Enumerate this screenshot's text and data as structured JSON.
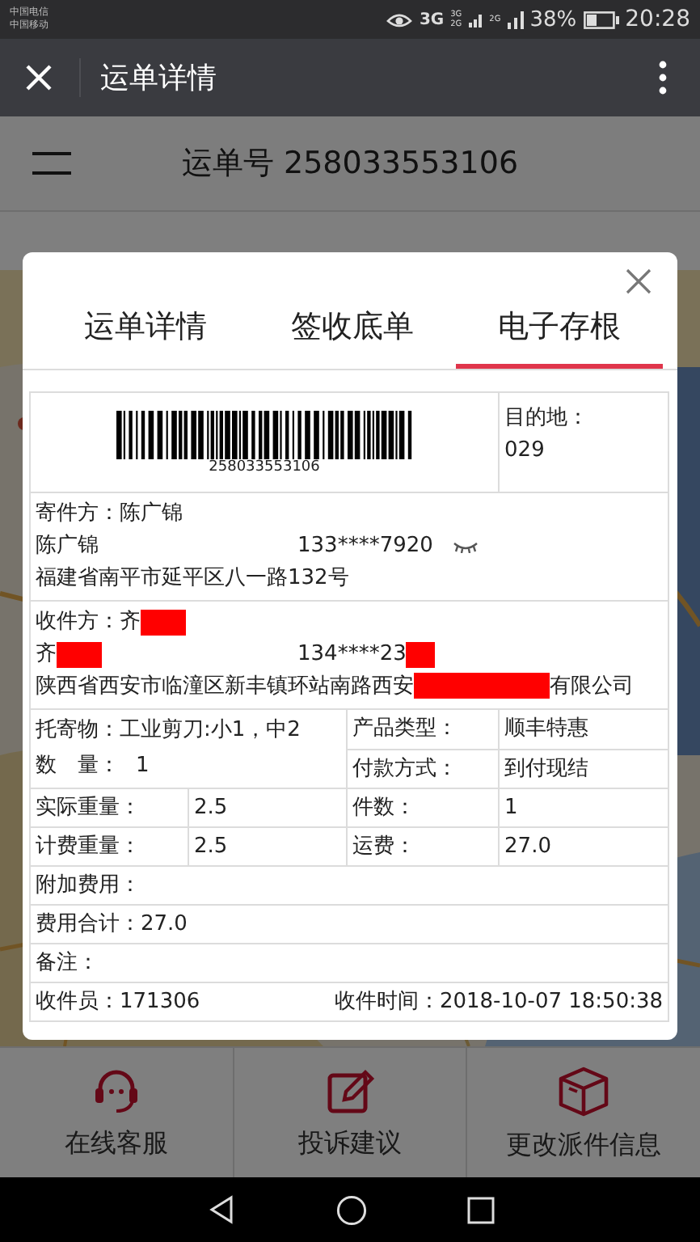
{
  "status_bar": {
    "carriers": [
      "中国电信",
      "中国移动"
    ],
    "network": "3G",
    "sim_1_labels": [
      "3G",
      "2G"
    ],
    "sim_2_label": "2G",
    "battery": "38%",
    "time": "20:28"
  },
  "app_bar": {
    "title": "运单详情"
  },
  "page": {
    "waybill_title": "运单号 258033553106"
  },
  "modal": {
    "tabs": [
      {
        "label": "运单详情",
        "selected": false
      },
      {
        "label": "签收底单",
        "selected": false
      },
      {
        "label": "电子存根",
        "selected": true
      }
    ],
    "barcode_number": "258033553106",
    "destination_label": "目的地：",
    "destination": "029",
    "sender": {
      "heading": "寄件方：陈广锦",
      "name": "陈广锦",
      "phone": "133****7920",
      "address": "福建省南平市延平区八一路132号"
    },
    "recipient": {
      "heading": "收件方：齐",
      "name": "齐",
      "phone": "134****23",
      "address_start": "陕西省西安市临潼区新丰镇环站南路西安",
      "address_end": "有限公司",
      "redacted": true
    },
    "goods": "托寄物：工业剪刀:小1，中2",
    "quantity_label": "数　量：",
    "quantity": "1",
    "pairs": [
      {
        "label": "产品类型：",
        "value": "顺丰特惠"
      },
      {
        "label": "付款方式：",
        "value": "到付现结"
      }
    ],
    "weights": [
      {
        "label": "实际重量：",
        "value": "2.5",
        "label_2": "件数：",
        "value_2": "1"
      },
      {
        "label": "计费重量：",
        "value": "2.5",
        "label_2": "运费：",
        "value_2": "27.0"
      }
    ],
    "lines": [
      "附加费用：",
      "费用合计：27.0",
      "备注："
    ],
    "courier": "收件员：171306",
    "time": "收件时间：2018-10-07 18:50:38"
  },
  "bottom_bar": [
    {
      "kind": "headset",
      "label": "在线客服"
    },
    {
      "kind": "edit",
      "label": "投诉建议"
    },
    {
      "kind": "box",
      "label": "更改派件信息"
    }
  ]
}
